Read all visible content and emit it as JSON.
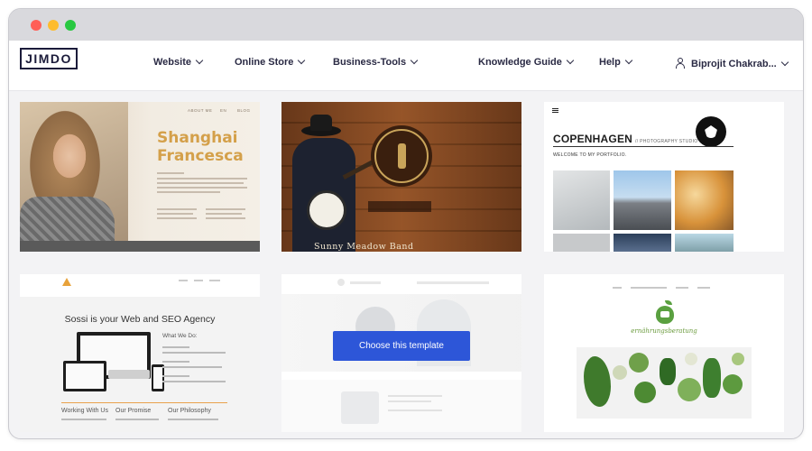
{
  "window": {
    "traffic_lights": [
      "red",
      "yellow",
      "green"
    ]
  },
  "colors": {
    "accent": "#2d56d8",
    "logo": "#1b1b3a"
  },
  "nav": {
    "logo": "JIMDO",
    "items": [
      {
        "label": "Website"
      },
      {
        "label": "Online Store"
      },
      {
        "label": "Business-Tools"
      },
      {
        "label": "Knowledge Guide"
      },
      {
        "label": "Help"
      }
    ],
    "user": {
      "label": "Biprojit Chakrab...",
      "icon": "user-icon"
    }
  },
  "templates": {
    "t1": {
      "title_line1": "Shanghai",
      "title_line2": "Francesca",
      "menu": [
        "ABOUT ME",
        "EN",
        "BLOG"
      ]
    },
    "t2": {
      "caption": "Sunny Meadow Band"
    },
    "t3": {
      "heading": "COPENHAGEN",
      "subheading": "// PHOTOGRAPHY STUDIO",
      "welcome": "WELCOME TO MY PORTFOLIO."
    },
    "t4": {
      "headline": "Sossi is your Web and SEO Agency",
      "side_title": "What We Do:",
      "footer": [
        "Working With Us",
        "Our Promise",
        "Our Philosophy"
      ]
    },
    "t5": {
      "button": "Choose this template"
    },
    "t6": {
      "brand": "ernährungsberatung"
    }
  }
}
